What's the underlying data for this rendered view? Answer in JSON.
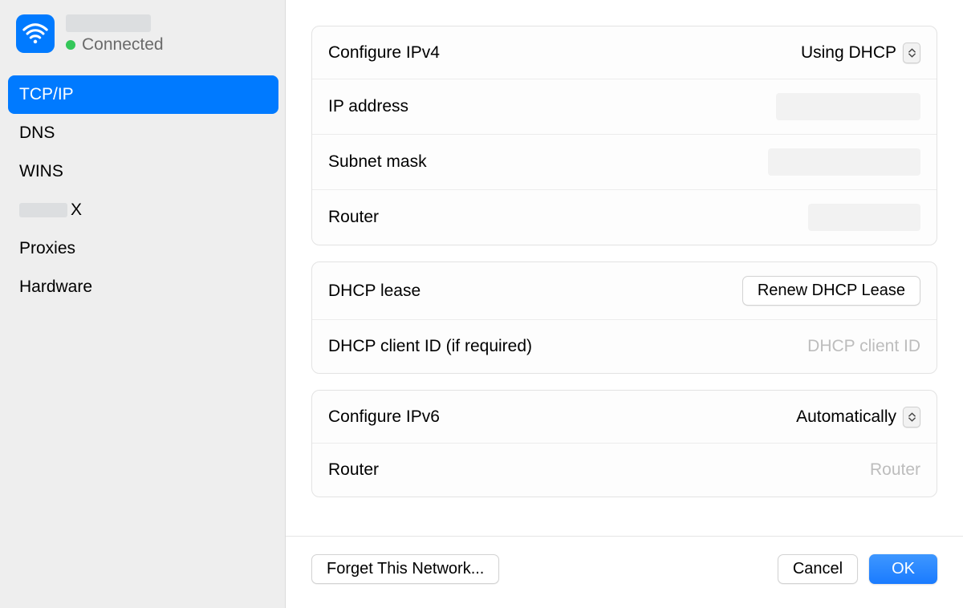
{
  "sidebar": {
    "status_label": "Connected",
    "items": [
      {
        "label": "TCP/IP",
        "selected": true
      },
      {
        "label": "DNS",
        "selected": false
      },
      {
        "label": "WINS",
        "selected": false
      },
      {
        "label": "X",
        "selected": false,
        "redacted_prefix": true
      },
      {
        "label": "Proxies",
        "selected": false
      },
      {
        "label": "Hardware",
        "selected": false
      }
    ]
  },
  "panel": {
    "ipv4": {
      "configure_label": "Configure IPv4",
      "configure_value": "Using DHCP",
      "ip_label": "IP address",
      "subnet_label": "Subnet mask",
      "router_label": "Router"
    },
    "dhcp": {
      "lease_label": "DHCP lease",
      "renew_button": "Renew DHCP Lease",
      "client_id_label": "DHCP client ID (if required)",
      "client_id_placeholder": "DHCP client ID"
    },
    "ipv6": {
      "configure_label": "Configure IPv6",
      "configure_value": "Automatically",
      "router_label": "Router",
      "router_placeholder": "Router"
    }
  },
  "footer": {
    "forget": "Forget This Network...",
    "cancel": "Cancel",
    "ok": "OK"
  }
}
